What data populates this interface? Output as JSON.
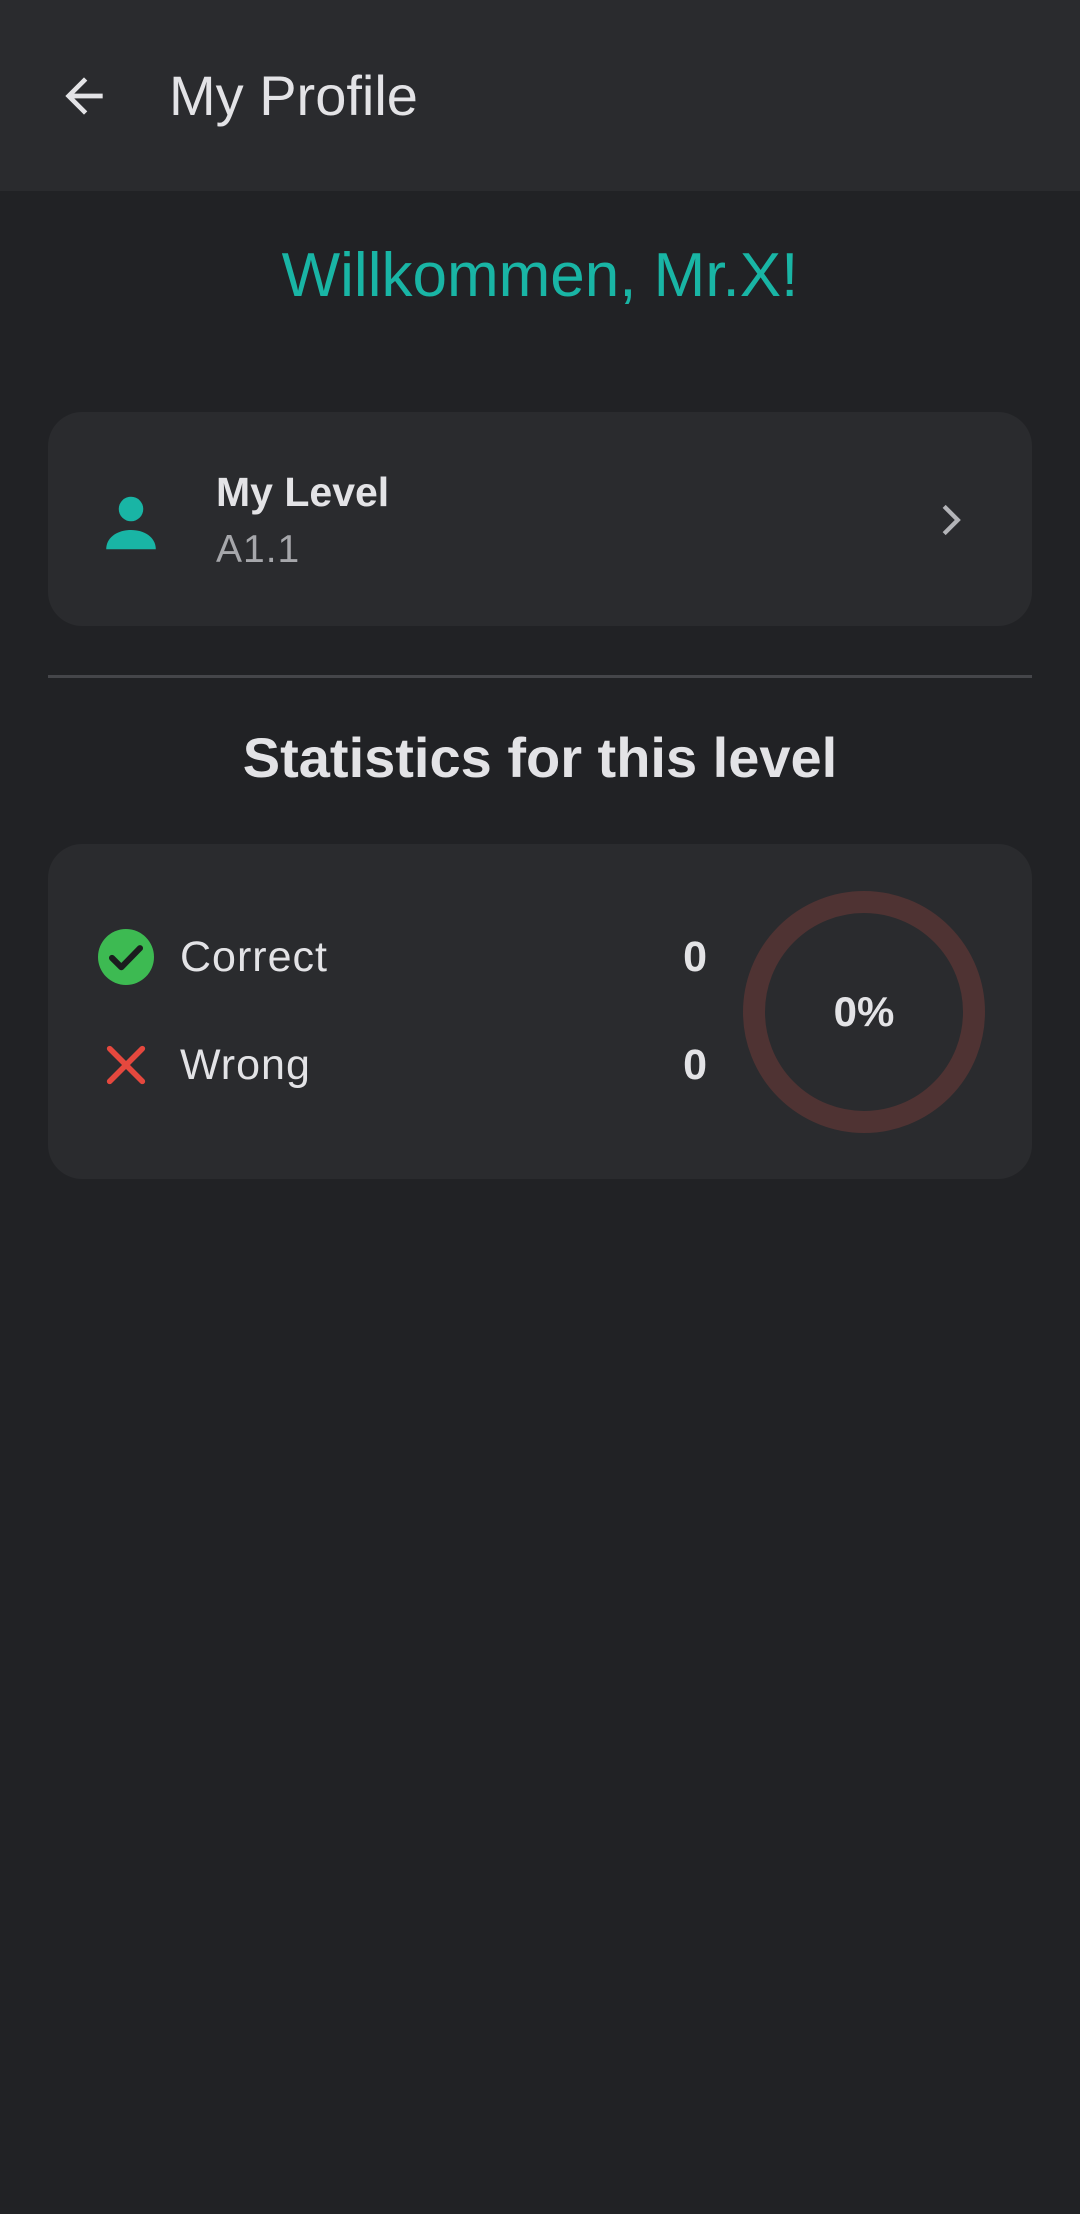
{
  "appbar": {
    "title": "My Profile",
    "back_icon": "arrow-back-icon"
  },
  "welcome_text": "Willkommen, Mr.X!",
  "level_card": {
    "icon": "person-icon",
    "title": "My Level",
    "value": "A1.1",
    "chevron_icon": "chevron-right-icon"
  },
  "stats": {
    "heading": "Statistics for this level",
    "correct": {
      "icon": "check-circle-icon",
      "label": "Correct",
      "value": "0"
    },
    "wrong": {
      "icon": "close-icon",
      "label": "Wrong",
      "value": "0"
    },
    "progress": {
      "fraction": 0,
      "label": "0%"
    }
  },
  "colors": {
    "background": "#212225",
    "surface": "#2a2b2e",
    "accent": "#19b5a5",
    "correct": "#3dba52",
    "wrong": "#e5483e",
    "ring_track": "#4f3333"
  }
}
